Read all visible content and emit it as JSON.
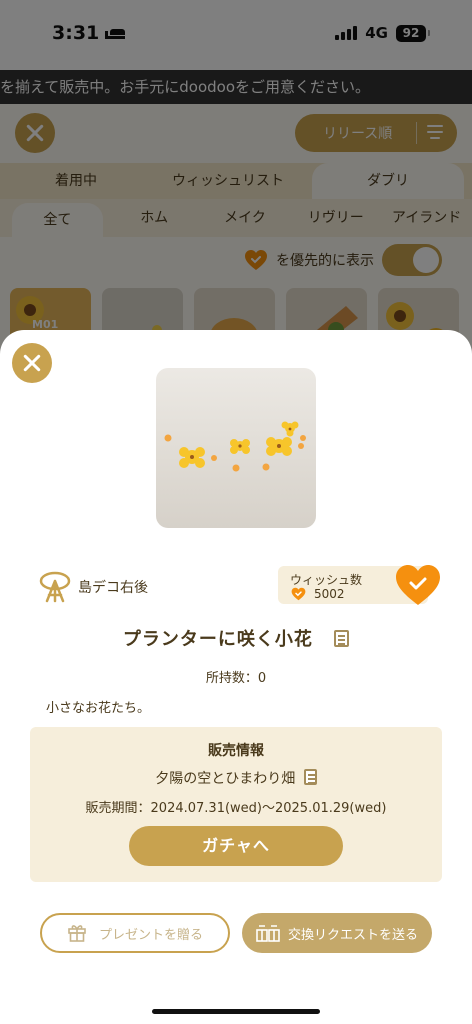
{
  "status_bar": {
    "time": "3:31",
    "network": "4G",
    "battery": "92"
  },
  "background": {
    "marquee": "を揃えて販売中。お手元にdoodooをご用意ください。",
    "sort_label": "リリース順",
    "main_tabs": [
      "着用中",
      "ウィッシュリスト",
      "ダブリ"
    ],
    "sub_tabs": [
      "全て",
      "ホム",
      "メイク",
      "リヴリー",
      "アイランド"
    ],
    "priority_label": "を優先的に表示",
    "thumb_label": "M01"
  },
  "item": {
    "location": "島デコ右後",
    "wish_label": "ウィッシュ数",
    "wish_count": "5002",
    "name": "プランターに咲く小花",
    "owned": "所持数：0",
    "description": "小さなお花たち。"
  },
  "sales": {
    "title": "販売情報",
    "event": "夕陽の空とひまわり畑",
    "period": "販売期間：2024.07.31(wed)〜2025.01.29(wed)",
    "gacha_button": "ガチャへ"
  },
  "actions": {
    "present": "プレゼントを贈る",
    "trade": "交換リクエストを送る"
  },
  "colors": {
    "accent": "#c8a24f",
    "heart": "#f5900f",
    "panel": "#f6eedb"
  }
}
